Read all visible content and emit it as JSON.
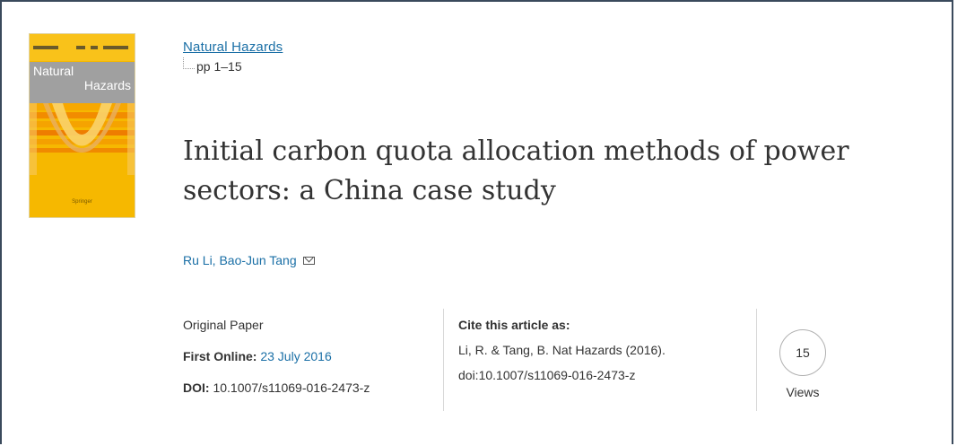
{
  "cover": {
    "title_line1": "Natural",
    "title_line2": "Hazards",
    "publisher": "Springer"
  },
  "journal": {
    "name": "Natural Hazards",
    "pages": "pp 1–15"
  },
  "article": {
    "title": "Initial carbon quota allocation methods of power sectors: a China case study",
    "authors": "Ru Li, Bao-Jun Tang"
  },
  "meta": {
    "type": "Original Paper",
    "first_online_label": "First Online:",
    "first_online_date": "23 July 2016",
    "doi_label": "DOI:",
    "doi_value": "10.1007/s11069-016-2473-z"
  },
  "cite": {
    "heading": "Cite this article as:",
    "line1": "Li, R. & Tang, B. Nat Hazards (2016).",
    "line2": "doi:10.1007/s11069-016-2473-z"
  },
  "metrics": {
    "views_count": "15",
    "views_label": "Views"
  },
  "icons": {
    "author_contact": "mail-icon"
  },
  "colors": {
    "link": "#1a6fa6",
    "cover_yellow": "#f6b800",
    "frame": "#3a4a5c"
  }
}
